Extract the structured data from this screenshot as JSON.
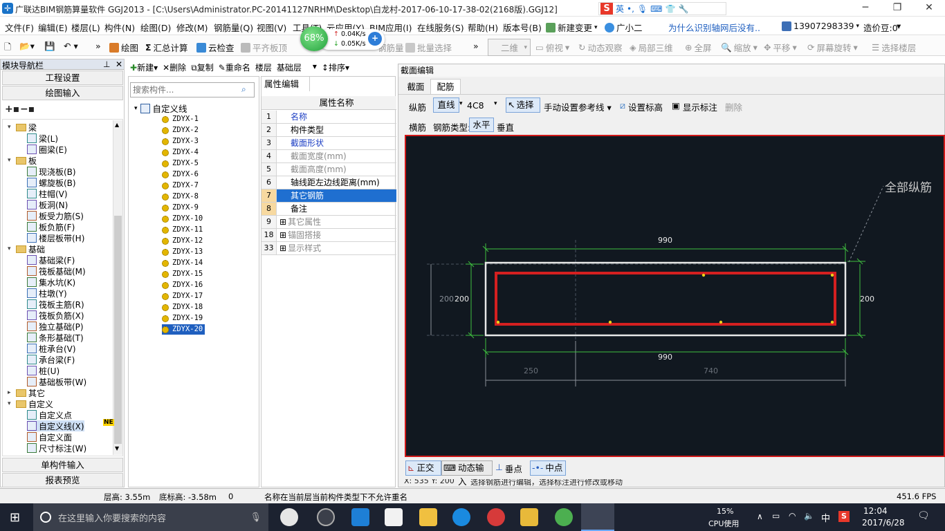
{
  "window": {
    "title": "广联达BIM钢筋算量软件 GGJ2013 - [C:\\Users\\Administrator.PC-20141127NRHM\\Desktop\\白龙村-2017-06-10-17-38-02(2168版).GGJ12]",
    "ime_label": "英"
  },
  "menu": [
    "文件(F)",
    "编辑(E)",
    "楼层(L)",
    "构件(N)",
    "绘图(D)",
    "修改(M)",
    "钢筋量(Q)",
    "视图(V)",
    "工具(T)",
    "云应用(Y)",
    "BIM应用(I)",
    "在线服务(S)",
    "帮助(H)",
    "版本号(B)",
    "新建变更",
    "广小二",
    "为什么识别轴网后没有..",
    "13907298339",
    "造价豆:0"
  ],
  "toolbar": {
    "draw": "绘图",
    "sum": "汇总计算",
    "cloud_check": "云检查",
    "level_top": "平齐板顶",
    "find": "钢筋量",
    "batch": "批量选择",
    "view_mode": "二维",
    "top_view": "俯视",
    "dyn_view": "动态观察",
    "local3d": "局部三维",
    "full": "全屏",
    "zoom": "缩放",
    "pan": "平移",
    "rotate": "屏幕旋转",
    "sel_floor": "选择楼层"
  },
  "net": {
    "percent": "68%",
    "up": "0.04K/s",
    "down": "0.05K/s"
  },
  "nav": {
    "header": "模块导航栏",
    "btn_engineering": "工程设置",
    "btn_draw": "绘图输入",
    "tree": [
      {
        "label": "梁",
        "type": "folder",
        "level": 0
      },
      {
        "label": "梁(L)",
        "level": 1
      },
      {
        "label": "圈梁(E)",
        "level": 1
      },
      {
        "label": "板",
        "type": "folder",
        "level": 0
      },
      {
        "label": "现浇板(B)",
        "level": 1
      },
      {
        "label": "螺旋板(B)",
        "level": 1
      },
      {
        "label": "柱帽(V)",
        "level": 1
      },
      {
        "label": "板洞(N)",
        "level": 1
      },
      {
        "label": "板受力筋(S)",
        "level": 1
      },
      {
        "label": "板负筋(F)",
        "level": 1
      },
      {
        "label": "楼层板带(H)",
        "level": 1
      },
      {
        "label": "基础",
        "type": "folder",
        "level": 0
      },
      {
        "label": "基础梁(F)",
        "level": 1
      },
      {
        "label": "筏板基础(M)",
        "level": 1
      },
      {
        "label": "集水坑(K)",
        "level": 1
      },
      {
        "label": "柱墩(Y)",
        "level": 1
      },
      {
        "label": "筏板主筋(R)",
        "level": 1
      },
      {
        "label": "筏板负筋(X)",
        "level": 1
      },
      {
        "label": "独立基础(P)",
        "level": 1
      },
      {
        "label": "条形基础(T)",
        "level": 1
      },
      {
        "label": "桩承台(V)",
        "level": 1
      },
      {
        "label": "承台梁(F)",
        "level": 1
      },
      {
        "label": "桩(U)",
        "level": 1
      },
      {
        "label": "基础板带(W)",
        "level": 1
      },
      {
        "label": "其它",
        "type": "folder",
        "level": 0
      },
      {
        "label": "自定义",
        "type": "folder",
        "level": 0
      },
      {
        "label": "自定义点",
        "level": 1
      },
      {
        "label": "自定义线(X)",
        "level": 1
      },
      {
        "label": "自定义面",
        "level": 1
      },
      {
        "label": "尺寸标注(W)",
        "level": 1
      }
    ],
    "new_badge": "NE",
    "btn_single": "单构件输入",
    "btn_report": "报表预览"
  },
  "comp_toolbar": {
    "new": "新建",
    "delete": "删除",
    "copy": "复制",
    "rename": "重命名",
    "floor_label": "楼层",
    "floor": "基础层",
    "sort": "排序"
  },
  "comp": {
    "search_placeholder": "搜索构件...",
    "root": "自定义线",
    "items": [
      "ZDYX-1",
      "ZDYX-2",
      "ZDYX-3",
      "ZDYX-4",
      "ZDYX-5",
      "ZDYX-6",
      "ZDYX-7",
      "ZDYX-8",
      "ZDYX-9",
      "ZDYX-10",
      "ZDYX-11",
      "ZDYX-12",
      "ZDYX-13",
      "ZDYX-14",
      "ZDYX-15",
      "ZDYX-16",
      "ZDYX-17",
      "ZDYX-18",
      "ZDYX-19",
      "ZDYX-20"
    ],
    "selected": "ZDYX-20"
  },
  "prop": {
    "tab": "属性编辑",
    "col_header": "属性名称",
    "rows": [
      {
        "n": "1",
        "label": "名称"
      },
      {
        "n": "2",
        "label": "构件类型"
      },
      {
        "n": "3",
        "label": "截面形状"
      },
      {
        "n": "4",
        "label": "截面宽度(mm)"
      },
      {
        "n": "5",
        "label": "截面高度(mm)"
      },
      {
        "n": "6",
        "label": "轴线距左边线距离(mm)"
      },
      {
        "n": "7",
        "label": "其它钢筋"
      },
      {
        "n": "8",
        "label": "备注"
      },
      {
        "n": "9",
        "label": "其它属性"
      },
      {
        "n": "18",
        "label": "锚固搭接"
      },
      {
        "n": "33",
        "label": "显示样式"
      }
    ]
  },
  "section": {
    "title": "截面编辑",
    "tab_section": "截面",
    "tab_rebar": "配筋",
    "long_bar": "纵筋",
    "line_type": "直线",
    "spec": "4C8",
    "select": "选择",
    "ref_line": "手动设置参考线",
    "set_elev": "设置标高",
    "show_dim": "显示标注",
    "delete": "删除",
    "transverse": "横筋",
    "rebar_type_label": "钢筋类型:",
    "horizontal": "水平",
    "vertical": "垂直",
    "all_long": "全部纵筋",
    "dim_top": "990",
    "dim_bottom": "990",
    "dim_left": "200",
    "dim_left2": "200",
    "dim_right": "200",
    "dim_seg1": "250",
    "dim_seg2": "740",
    "snap_ortho": "正交",
    "snap_dyn": "动态输入",
    "snap_perp": "垂点",
    "snap_mid": "中点",
    "coord_hint": "X: 535 Y: 200",
    "hint": "选择钢筋进行编辑，选择标注进行修改或移动"
  },
  "status": {
    "floor_h": "层高: 3.55m",
    "bottom": "底标高: -3.58m",
    "zero": "0",
    "msg": "名称在当前层当前构件类型下不允许重名",
    "fps": "451.6 FPS"
  },
  "taskbar": {
    "search": "在这里输入你要搜索的内容",
    "cpu": "15%",
    "cpu_label": "CPU使用",
    "lang": "中",
    "time": "12:04",
    "date": "2017/6/28"
  }
}
